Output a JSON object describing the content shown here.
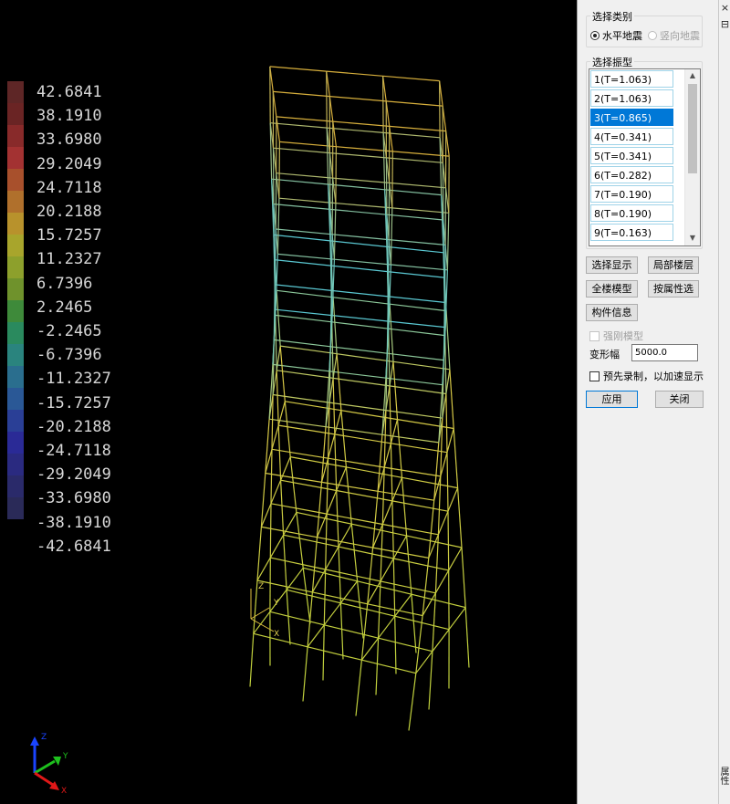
{
  "legend": {
    "values": [
      "42.6841",
      "38.1910",
      "33.6980",
      "29.2049",
      "24.7118",
      "20.2188",
      "15.7257",
      "11.2327",
      "6.7396",
      "2.2465",
      "-2.2465",
      "-6.7396",
      "-11.2327",
      "-15.7257",
      "-20.2188",
      "-24.7118",
      "-29.2049",
      "-33.6980",
      "-38.1910",
      "-42.6841"
    ],
    "colors": [
      "#5e2626",
      "#6a2424",
      "#882a2a",
      "#a33232",
      "#a8502c",
      "#b0702c",
      "#b8922c",
      "#a8a52c",
      "#8da02c",
      "#6f922c",
      "#3e8a3a",
      "#2a8a5e",
      "#2a847e",
      "#2a6e8e",
      "#2a5896",
      "#2a3f96",
      "#2a2a96",
      "#2a2a80",
      "#2a2a6a",
      "#2a2a58"
    ]
  },
  "model_axes": {
    "z": "Z",
    "y": "Y",
    "x": "X"
  },
  "triad": {
    "z": "Z",
    "y": "Y",
    "x": "X"
  },
  "side_strip": {
    "close": "×",
    "pin": "⊟",
    "tab": "属性"
  },
  "panel": {
    "category_title": "选择类别",
    "radio_horizontal": "水平地震",
    "radio_vertical": "竖向地震",
    "mode_title": "选择振型",
    "modes": [
      "1(T=1.063)",
      "2(T=1.063)",
      "3(T=0.865)",
      "4(T=0.341)",
      "5(T=0.341)",
      "6(T=0.282)",
      "7(T=0.190)",
      "8(T=0.190)",
      "9(T=0.163)"
    ],
    "selected_mode": "3(T=0.865)",
    "btn_select_display": "选择显示",
    "btn_local_floor": "局部楼层",
    "btn_whole_model": "全楼模型",
    "btn_by_attribute": "按属性选",
    "btn_member_info": "构件信息",
    "rigid_model": "强刚模型",
    "deform_label": "变形幅",
    "deform_value": "5000.0",
    "prerecord": "预先录制，以加速显示",
    "btn_apply": "应用",
    "btn_close": "关闭"
  }
}
